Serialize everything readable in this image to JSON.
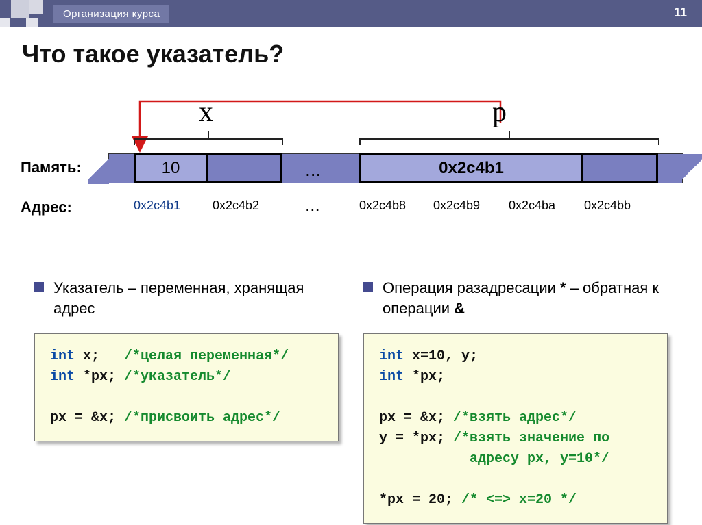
{
  "header": {
    "breadcrumb": "Организация курса",
    "page": "11"
  },
  "title": "Что такое указатель?",
  "diagram": {
    "var_x": "x",
    "var_p": "p",
    "mem_label": "Память:",
    "addr_label": "Адрес:",
    "x_cell": "10",
    "p_cell": "0x2c4b1",
    "ellipsis": "...",
    "addrs": [
      "0x2c4b1",
      "0x2c4b2",
      "0x2c4b8",
      "0x2c4b9",
      "0x2c4ba",
      "0x2c4bb"
    ]
  },
  "columns": {
    "left": {
      "bullet": "Указатель – переменная, хранящая адрес",
      "code": {
        "l1a": "int",
        "l1b": " x;   ",
        "l1c": "/*целая переменная*/",
        "l2a": "int",
        "l2b": " *px; ",
        "l2c": "/*указатель*/",
        "blank": "",
        "l3a": "px = &x; ",
        "l3b": "/*присвоить адрес*/"
      }
    },
    "right": {
      "bullet_a": "Операция разадресации ",
      "bullet_star": "*",
      "bullet_b": " – обратная к операции ",
      "bullet_amp": "&",
      "code": {
        "l1a": "int",
        "l1b": " x=10, y;",
        "l2a": "int",
        "l2b": " *px;",
        "blank": "",
        "l3a": "px = &x; ",
        "l3b": "/*взять адрес*/",
        "l4a": "y = *px; ",
        "l4b": "/*взять значение по",
        "l5": "           адресу px, y=10*/",
        "blank2": "",
        "l6a": "*px = 20; ",
        "l6b": "/* <=> x=20 */"
      }
    }
  }
}
